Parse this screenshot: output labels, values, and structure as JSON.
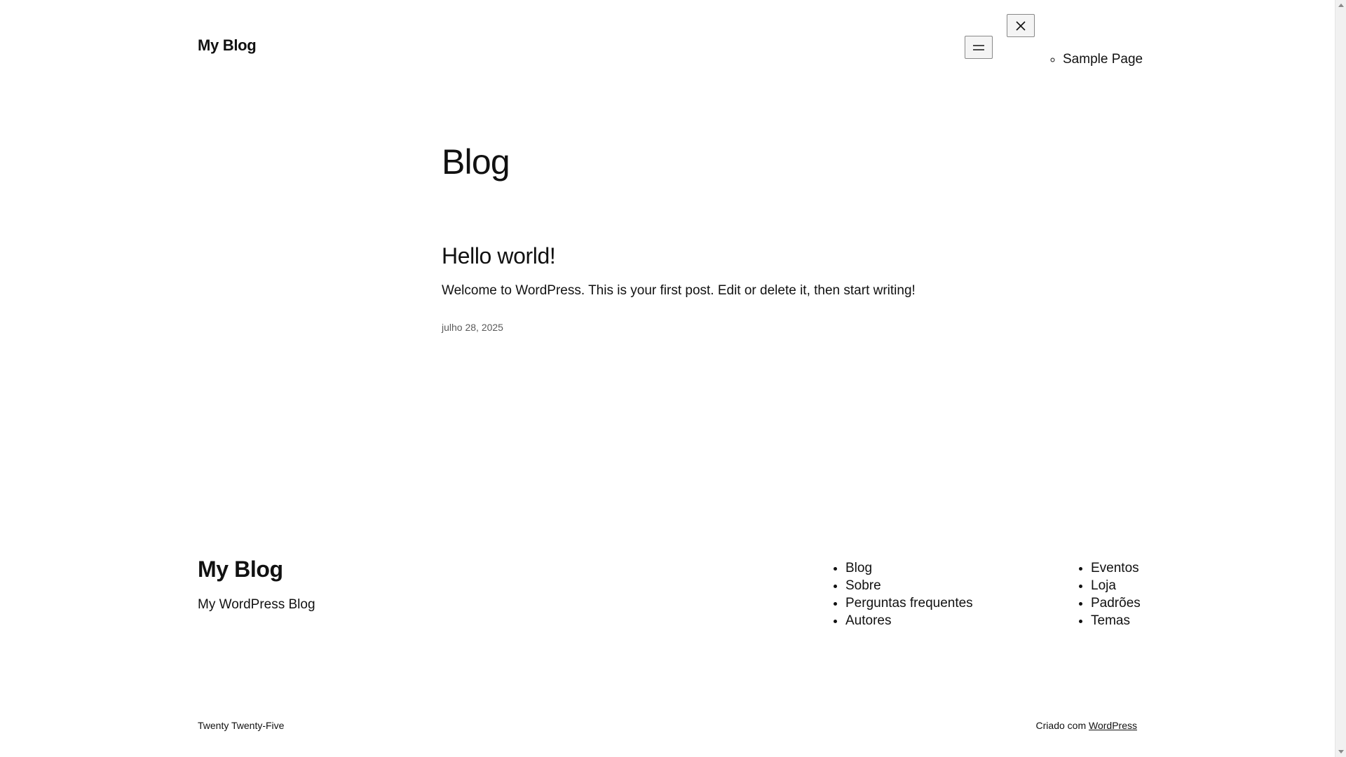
{
  "header": {
    "site_title": "My Blog",
    "menu_toggle_icon": "hamburger-icon",
    "menu_close_icon": "close-icon",
    "nav_items": [
      "Sample Page"
    ]
  },
  "main": {
    "page_heading": "Blog",
    "post": {
      "title": "Hello world!",
      "excerpt": "Welcome to WordPress. This is your first post. Edit or delete it, then start writing!",
      "date": "julho 28, 2025"
    }
  },
  "footer": {
    "site_title": "My Blog",
    "tagline": "My WordPress Blog",
    "nav_col1": [
      "Blog",
      "Sobre",
      "Perguntas frequentes",
      "Autores"
    ],
    "nav_col2": [
      "Eventos",
      "Loja",
      "Padrões",
      "Temas"
    ],
    "theme_credit": "Twenty Twenty-Five",
    "powered_prefix": "Criado com",
    "powered_link": "WordPress"
  }
}
